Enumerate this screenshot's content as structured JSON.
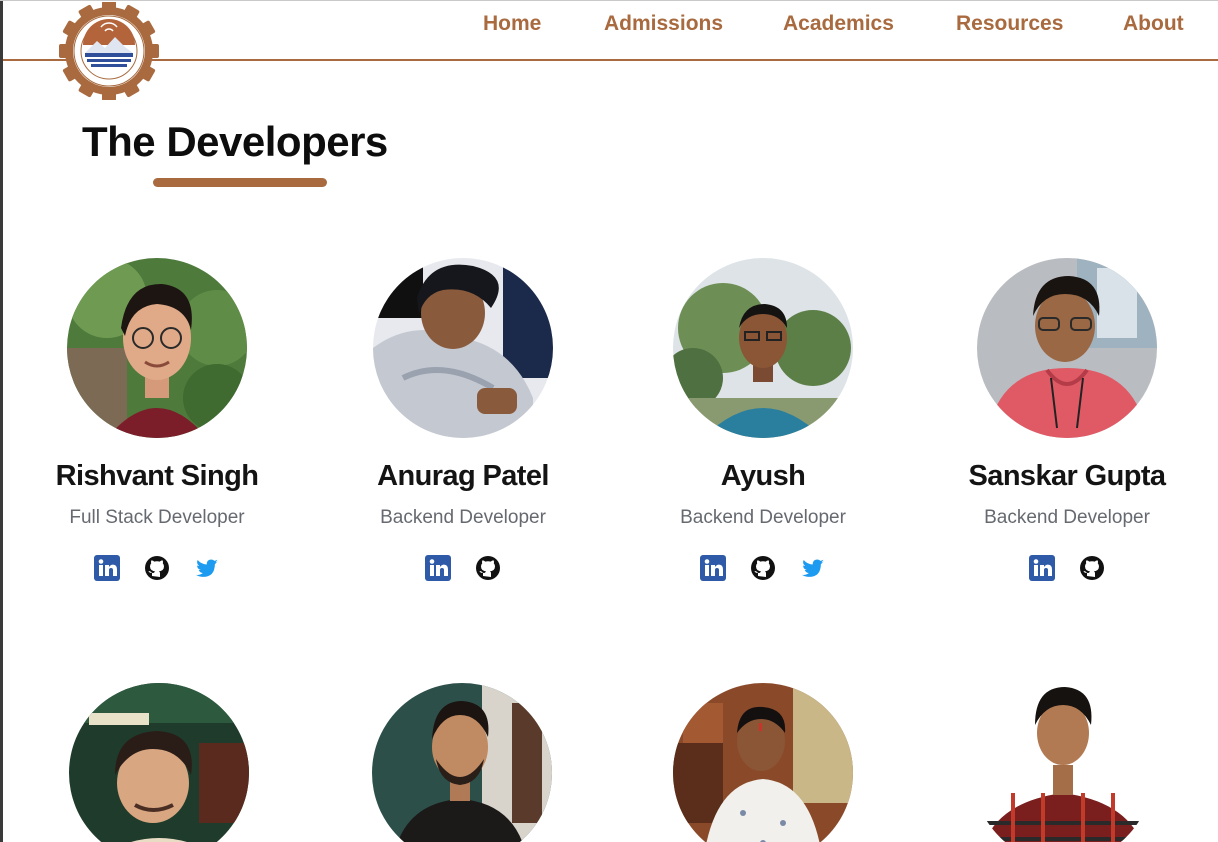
{
  "nav": {
    "items": [
      {
        "label": "Home"
      },
      {
        "label": "Admissions"
      },
      {
        "label": "Academics"
      },
      {
        "label": "Resources"
      },
      {
        "label": "About"
      }
    ]
  },
  "page": {
    "title": "The Developers"
  },
  "brand": {
    "accent": "#a86a3e",
    "linkedin": "#0a66c2",
    "github": "#111111",
    "twitter": "#1d9bf0"
  },
  "developers": [
    {
      "name": "Rishvant Singh",
      "role": "Full Stack Developer",
      "socials": [
        "linkedin-icon",
        "github-icon",
        "twitter-icon"
      ]
    },
    {
      "name": "Anurag Patel",
      "role": "Backend Developer",
      "socials": [
        "linkedin-icon",
        "github-icon"
      ]
    },
    {
      "name": "Ayush",
      "role": "Backend Developer",
      "socials": [
        "linkedin-icon",
        "github-icon",
        "twitter-icon"
      ]
    },
    {
      "name": "Sanskar Gupta",
      "role": "Backend Developer",
      "socials": [
        "linkedin-icon",
        "github-icon"
      ]
    },
    {
      "name": "",
      "role": "",
      "socials": []
    },
    {
      "name": "",
      "role": "",
      "socials": []
    },
    {
      "name": "",
      "role": "",
      "socials": []
    },
    {
      "name": "",
      "role": "",
      "socials": []
    }
  ]
}
